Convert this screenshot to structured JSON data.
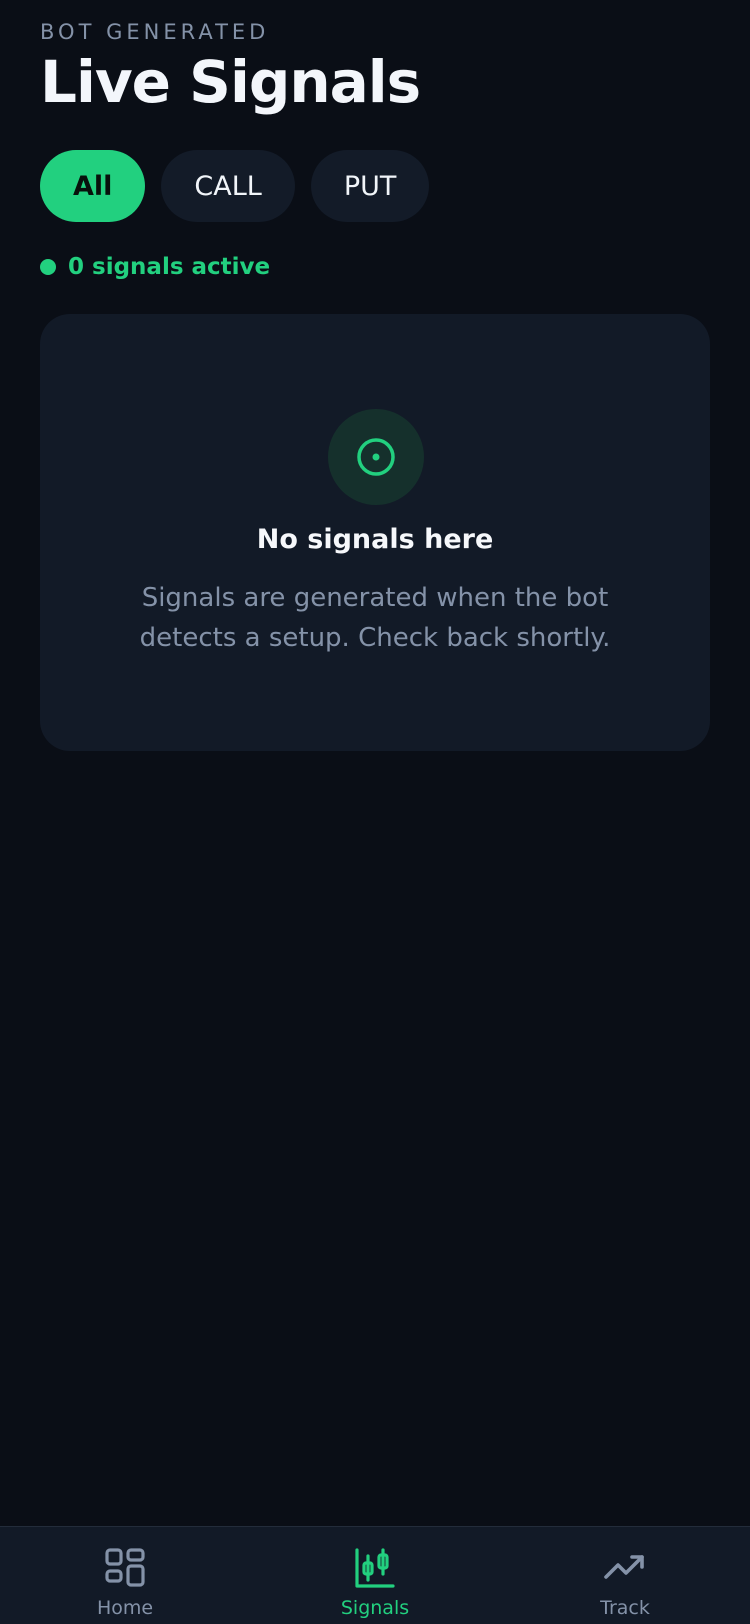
{
  "header": {
    "eyebrow": "BOT GENERATED",
    "title": "Live Signals"
  },
  "filters": [
    {
      "label": "All",
      "active": true
    },
    {
      "label": "CALL",
      "active": false
    },
    {
      "label": "PUT",
      "active": false
    }
  ],
  "status": {
    "text": "0 signals active",
    "color": "#22d07f"
  },
  "empty_state": {
    "icon": "target-icon",
    "title": "No signals here",
    "description": "Signals are generated when the bot detects a setup. Check back shortly."
  },
  "tabbar": {
    "items": [
      {
        "label": "Home",
        "icon": "grid-icon",
        "active": false
      },
      {
        "label": "Signals",
        "icon": "candlestick-icon",
        "active": true
      },
      {
        "label": "Track",
        "icon": "trending-up-icon",
        "active": false
      }
    ]
  },
  "colors": {
    "background": "#0a0e16",
    "card": "#121a27",
    "accent": "#22d07f",
    "muted": "#8492a8"
  }
}
